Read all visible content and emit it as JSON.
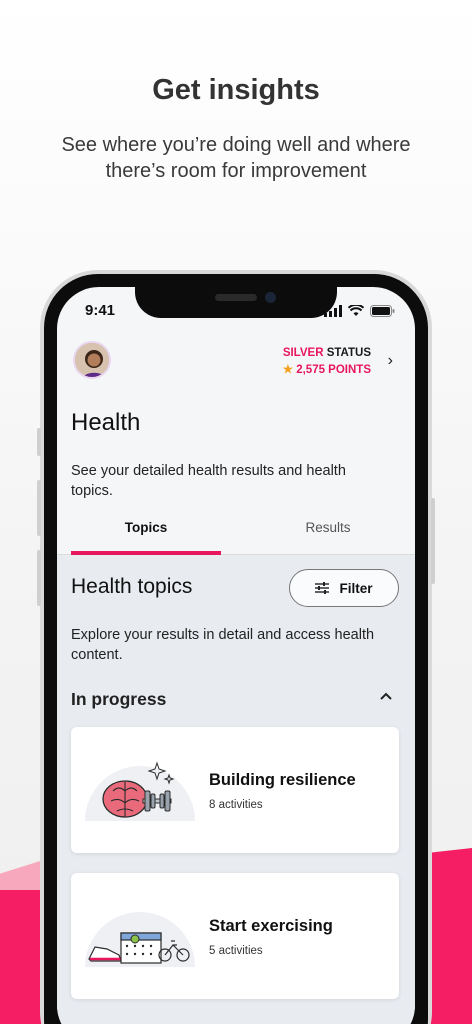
{
  "promo": {
    "title": "Get insights",
    "subtitle": "See where you’re doing well and where there’s room for improvement"
  },
  "status_bar": {
    "time": "9:41"
  },
  "profile": {
    "status_tier": "SILVER",
    "status_word": "STATUS",
    "points": "2,575 POINTS"
  },
  "header": {
    "title": "Health",
    "description": "See your detailed health results and health topics."
  },
  "tabs": [
    {
      "label": "Topics",
      "active": true
    },
    {
      "label": "Results",
      "active": false
    }
  ],
  "topics": {
    "title": "Health topics",
    "filter_label": "Filter",
    "description": "Explore your results in detail and access health content.",
    "section_label": "In progress",
    "cards": [
      {
        "title": "Building resilience",
        "subtitle": "8 activities",
        "icon": "brain-dumbbell-icon"
      },
      {
        "title": "Start exercising",
        "subtitle": "5 activities",
        "icon": "shoe-calendar-bike-icon"
      }
    ]
  },
  "colors": {
    "accent": "#e8175d",
    "star": "#f4a21d",
    "content_bg": "#e8ecf1"
  }
}
